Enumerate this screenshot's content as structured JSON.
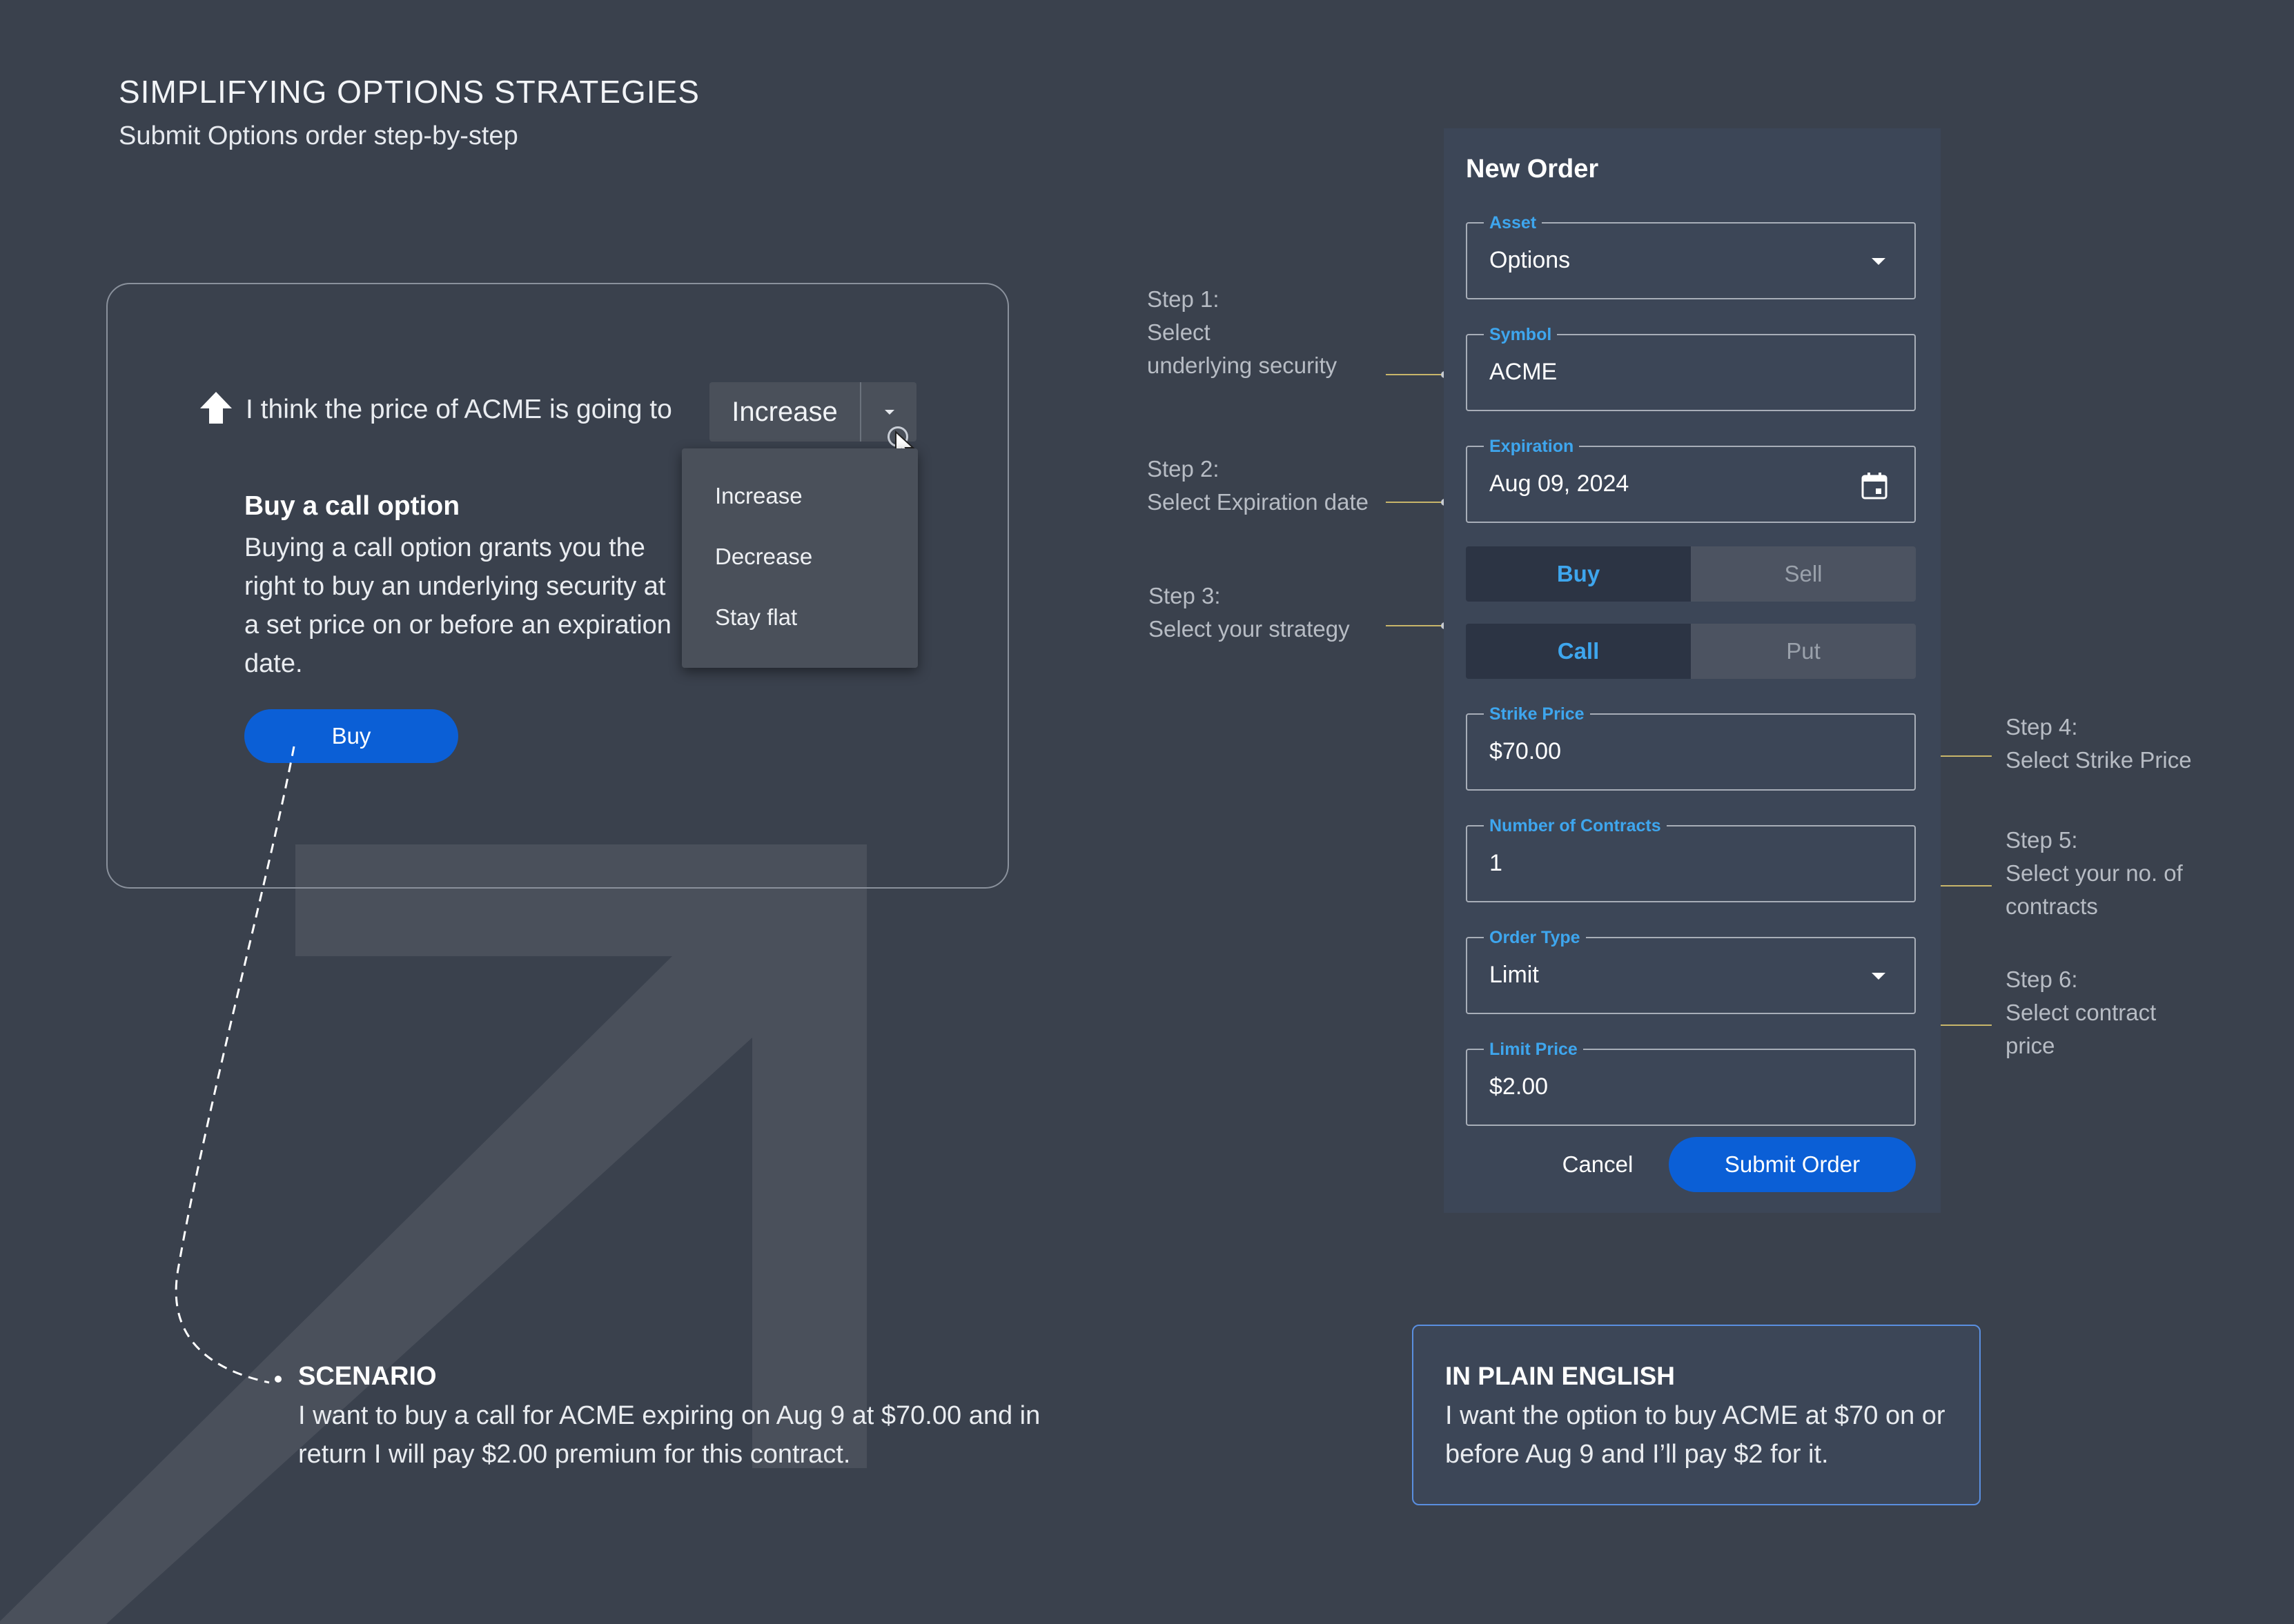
{
  "header": {
    "title": "SIMPLIFYING OPTIONS STRATEGIES",
    "subtitle": "Submit Options order step-by-step"
  },
  "strategy": {
    "prompt": "I think the price of ACME is going to",
    "selected": "Increase",
    "options": [
      "Increase",
      "Decrease",
      "Stay flat"
    ],
    "card_title": "Buy a call option",
    "card_text": "Buying a call option grants you the right to buy an underlying security at a set price on or before an expiration date.",
    "buy_label": "Buy"
  },
  "scenario": {
    "title": "SCENARIO",
    "text": "I want to buy a call for ACME expiring on Aug 9 at $70.00 and in return I will pay $2.00 premium for this contract."
  },
  "steps": [
    {
      "label": "Step 1:",
      "text": [
        "Select",
        "underlying security"
      ]
    },
    {
      "label": "Step 2:",
      "text": [
        "Select Expiration date"
      ]
    },
    {
      "label": "Step 3:",
      "text": [
        "Select your strategy"
      ]
    },
    {
      "label": "Step 4:",
      "text": [
        "Select Strike Price"
      ]
    },
    {
      "label": "Step 5:",
      "text": [
        "Select your no. of",
        "contracts"
      ]
    },
    {
      "label": "Step 6:",
      "text": [
        "Select contract",
        "price"
      ]
    }
  ],
  "order": {
    "title": "New Order",
    "asset": {
      "label": "Asset",
      "value": "Options"
    },
    "symbol": {
      "label": "Symbol",
      "value": "ACME"
    },
    "expiration": {
      "label": "Expiration",
      "value": "Aug 09, 2024"
    },
    "side": {
      "buy": "Buy",
      "sell": "Sell",
      "selected": "Buy"
    },
    "option_type": {
      "call": "Call",
      "put": "Put",
      "selected": "Call"
    },
    "strike": {
      "label": "Strike Price",
      "value": "$70.00"
    },
    "contracts": {
      "label": "Number of Contracts",
      "value": "1"
    },
    "order_type": {
      "label": "Order Type",
      "value": "Limit"
    },
    "limit_price": {
      "label": "Limit Price",
      "value": "$2.00"
    },
    "cancel_label": "Cancel",
    "submit_label": "Submit Order"
  },
  "plain_english": {
    "title": "IN PLAIN ENGLISH",
    "text": "I want the option to buy ACME at $70 on or before Aug 9 and I’ll pay $2 for it."
  },
  "colors": {
    "background": "#3a414d",
    "panel": "#3c4657",
    "accent_blue": "#0b5fd6",
    "label_blue": "#3ea6ee",
    "connector": "#c9b66a"
  }
}
